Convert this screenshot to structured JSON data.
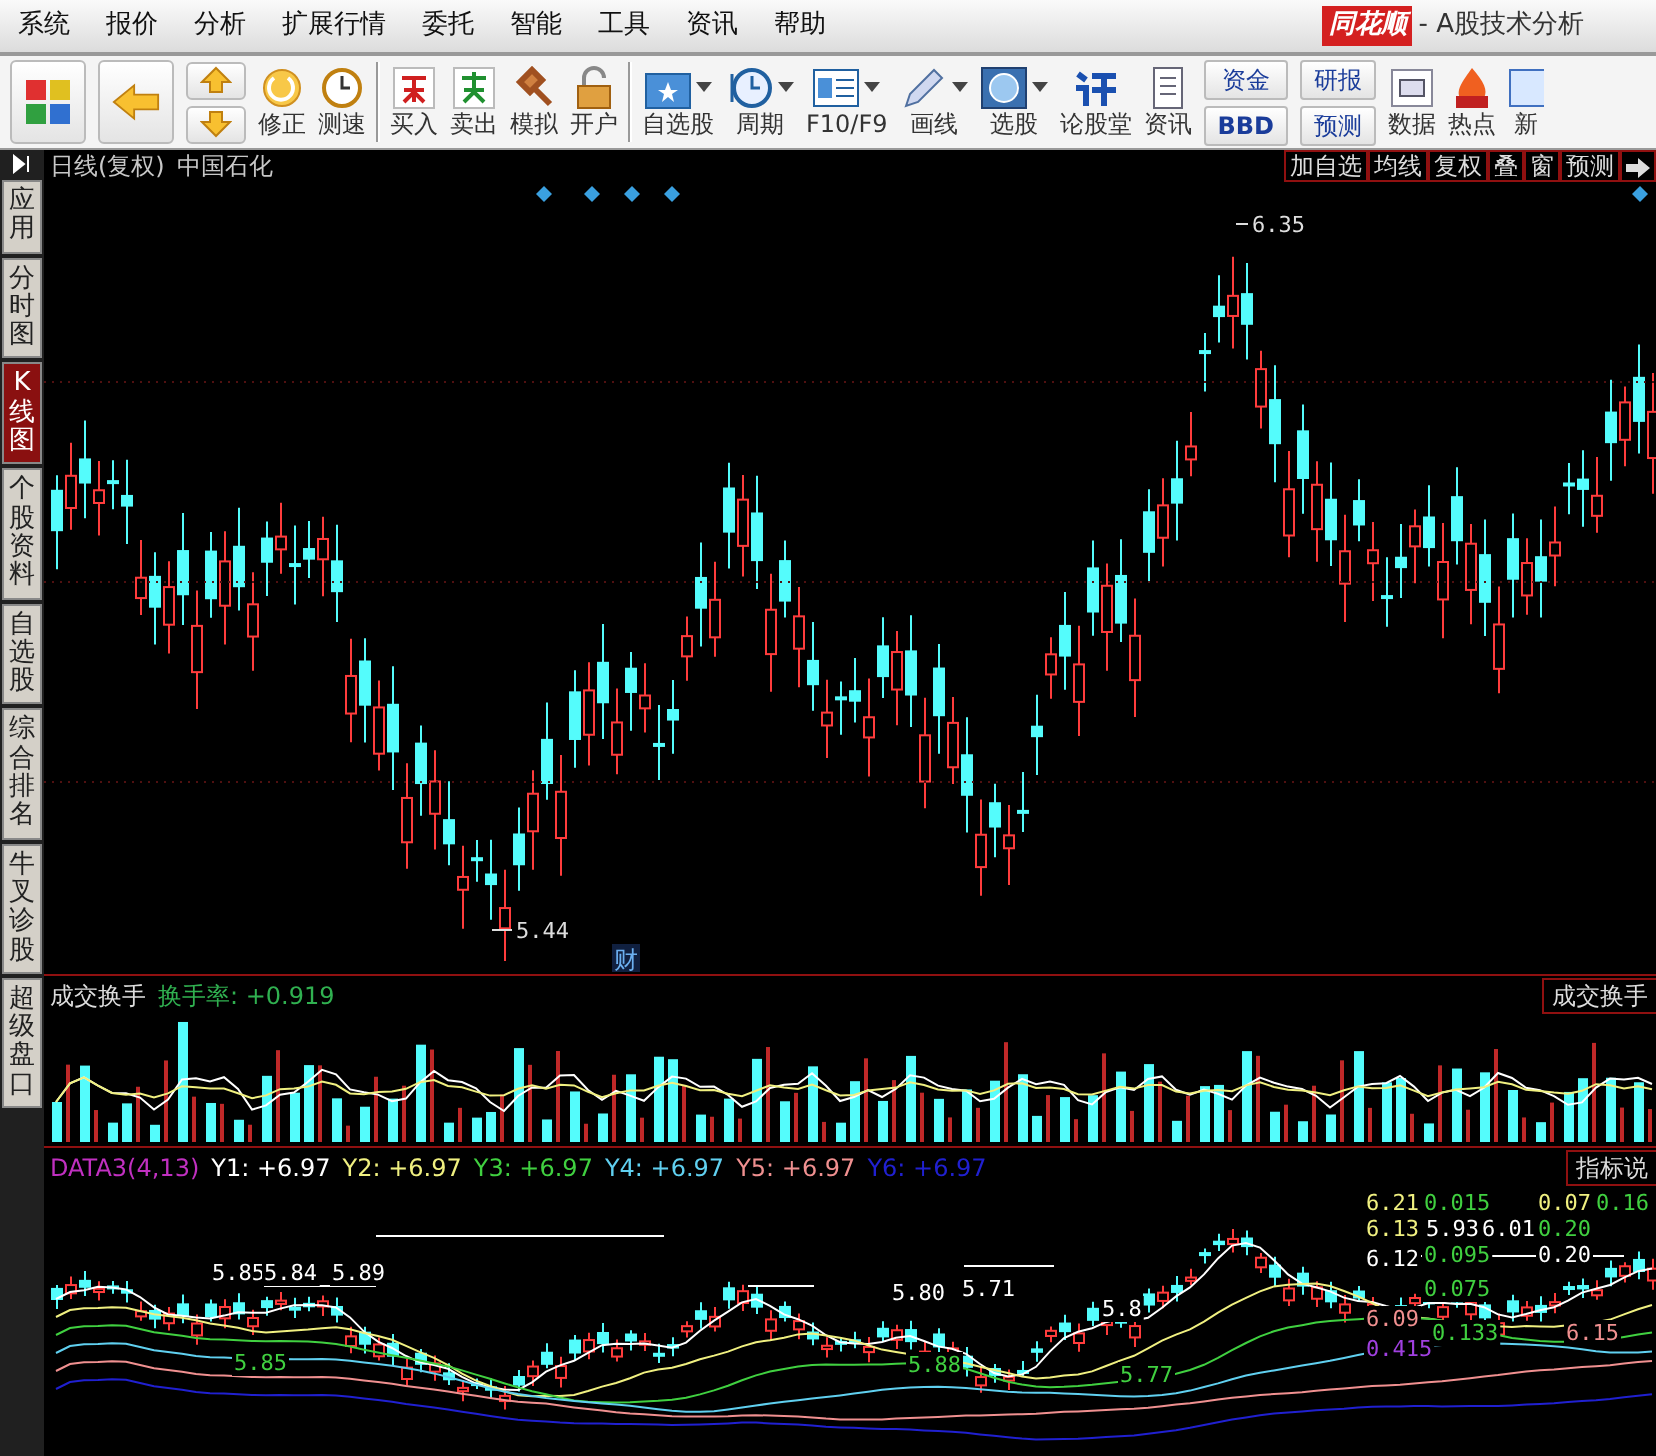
{
  "title_bar": {
    "logo": "同花顺",
    "title": "- A股技术分析"
  },
  "menu": [
    "系统",
    "报价",
    "分析",
    "扩展行情",
    "委托",
    "智能",
    "工具",
    "资讯",
    "帮助"
  ],
  "toolbar": [
    {
      "kind": "big"
    },
    {
      "kind": "big"
    },
    {
      "kind": "updown"
    },
    {
      "kind": "plain",
      "label": "修正"
    },
    {
      "kind": "plain",
      "label": "测速"
    },
    {
      "kind": "sep"
    },
    {
      "kind": "plain",
      "label": "买入"
    },
    {
      "kind": "plain",
      "label": "卖出"
    },
    {
      "kind": "plain",
      "label": "模拟"
    },
    {
      "kind": "plain",
      "label": "开户"
    },
    {
      "kind": "sep"
    },
    {
      "kind": "dropdown",
      "label": "自选股"
    },
    {
      "kind": "dropdown",
      "label": "周期"
    },
    {
      "kind": "dropdown",
      "label": "F10/F9"
    },
    {
      "kind": "dropdown",
      "label": "画线"
    },
    {
      "kind": "dropdown",
      "label": "选股"
    },
    {
      "kind": "plain",
      "label": "论股堂"
    },
    {
      "kind": "plain",
      "label": "资讯"
    },
    {
      "kind": "stack",
      "labels": [
        "资金",
        "BBD"
      ]
    },
    {
      "kind": "stack",
      "labels": [
        "研报",
        "预测"
      ]
    },
    {
      "kind": "plain",
      "label": "数据"
    },
    {
      "kind": "plain",
      "label": "热点"
    },
    {
      "kind": "plain",
      "label": "新"
    }
  ],
  "side_tabs": [
    {
      "label": "应用",
      "selected": false
    },
    {
      "label": "分时图",
      "selected": false
    },
    {
      "label": "K线图",
      "selected": true
    },
    {
      "label": "个股资料",
      "selected": false
    },
    {
      "label": "自选股",
      "selected": false
    },
    {
      "label": "综合排名",
      "selected": false
    },
    {
      "label": "牛叉诊股",
      "selected": false
    },
    {
      "label": "超级盘口",
      "selected": false
    }
  ],
  "chart_header": {
    "period": "日线(复权)",
    "stock": "中国石化",
    "buttons": [
      "加自选",
      "均线",
      "复权",
      "叠",
      "窗",
      "预测"
    ]
  },
  "price_chart": {
    "high_label": "6.35",
    "low_label": "5.44",
    "event_marker": "财"
  },
  "volume_panel": {
    "title": "成交换手",
    "reading": "换手率: +0.919",
    "side_label": "成交换手"
  },
  "indicator_panel": {
    "name": "DATA3(4,13)",
    "side_label": "指标说",
    "lines": [
      {
        "label": "Y1: +6.97",
        "color": "#ffffff"
      },
      {
        "label": "Y2: +6.97",
        "color": "#f0f080"
      },
      {
        "label": "Y3: +6.97",
        "color": "#40d040"
      },
      {
        "label": "Y4: +6.97",
        "color": "#60d0f0"
      },
      {
        "label": "Y5: +6.97",
        "color": "#f09090"
      },
      {
        "label": "Y6: +6.97",
        "color": "#2020d0"
      }
    ],
    "labels": [
      {
        "text": "5.85",
        "color": "#ffffff"
      },
      {
        "text": "5.84",
        "color": "#ffffff"
      },
      {
        "text": "5.89",
        "color": "#ffffff"
      },
      {
        "text": "5.85",
        "color": "#40d040"
      },
      {
        "text": "5.80",
        "color": "#ffffff"
      },
      {
        "text": "5.71",
        "color": "#ffffff"
      },
      {
        "text": "5.8",
        "color": "#ffffff"
      },
      {
        "text": "5.88",
        "color": "#40d040"
      },
      {
        "text": "5.77",
        "color": "#40d040"
      },
      {
        "text": "6.21",
        "color": "#f0f080"
      },
      {
        "text": "6.13",
        "color": "#f0f080"
      },
      {
        "text": "6.12",
        "color": "#ffffff"
      },
      {
        "text": "6.09",
        "color": "#f09090"
      },
      {
        "text": "0.015",
        "color": "#40d040"
      },
      {
        "text": "5.93",
        "color": "#ffffff"
      },
      {
        "text": "0.095",
        "color": "#40d040"
      },
      {
        "text": "0.075",
        "color": "#40d040"
      },
      {
        "text": "0.133",
        "color": "#40d040"
      },
      {
        "text": "0.415",
        "color": "#a040e0"
      },
      {
        "text": "6.01",
        "color": "#ffffff"
      },
      {
        "text": "0.07",
        "color": "#f0f080"
      },
      {
        "text": "0.20",
        "color": "#40d040"
      },
      {
        "text": "0.20",
        "color": "#ffffff"
      },
      {
        "text": "0.16",
        "color": "#40d040"
      },
      {
        "text": "6.15",
        "color": "#f09090"
      }
    ]
  }
}
